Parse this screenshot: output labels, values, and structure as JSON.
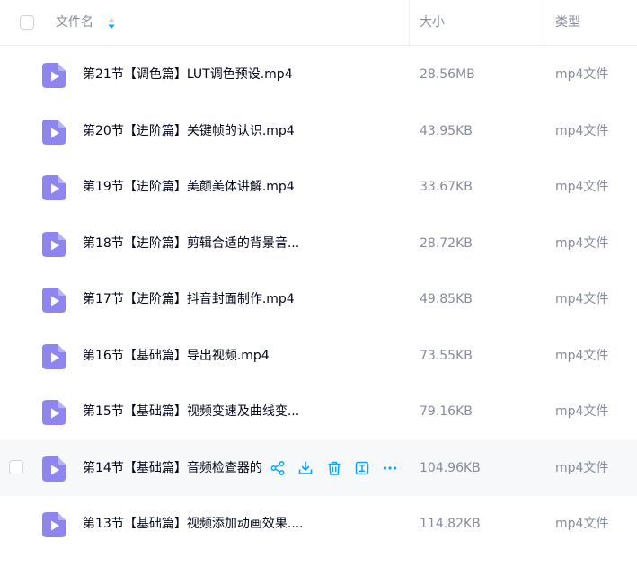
{
  "columns": {
    "name": "文件名",
    "size": "大小",
    "type": "类型"
  },
  "colors": {
    "accent": "#06a7ff",
    "file_icon": "#8e86ee",
    "muted": "#878c9c"
  },
  "rows": [
    {
      "name": "第21节【调色篇】LUT调色预设.mp4",
      "size": "28.56MB",
      "type": "mp4文件"
    },
    {
      "name": "第20节【进阶篇】关键帧的认识.mp4",
      "size": "43.95KB",
      "type": "mp4文件"
    },
    {
      "name": "第19节【进阶篇】美颜美体讲解.mp4",
      "size": "33.67KB",
      "type": "mp4文件"
    },
    {
      "name": "第18节【进阶篇】剪辑合适的背景音...",
      "size": "28.72KB",
      "type": "mp4文件"
    },
    {
      "name": "第17节【进阶篇】抖音封面制作.mp4",
      "size": "49.85KB",
      "type": "mp4文件"
    },
    {
      "name": "第16节【基础篇】导出视频.mp4",
      "size": "73.55KB",
      "type": "mp4文件"
    },
    {
      "name": "第15节【基础篇】视频变速及曲线变...",
      "size": "79.16KB",
      "type": "mp4文件"
    },
    {
      "name": "第14节【基础篇】音频检查器的使用.mp4",
      "size": "104.96KB",
      "type": "mp4文件",
      "hovered": true
    },
    {
      "name": "第13节【基础篇】视频添加动画效果....",
      "size": "114.82KB",
      "type": "mp4文件"
    }
  ],
  "row_actions": [
    "share-icon",
    "download-icon",
    "delete-icon",
    "rename-icon",
    "more-icon"
  ]
}
